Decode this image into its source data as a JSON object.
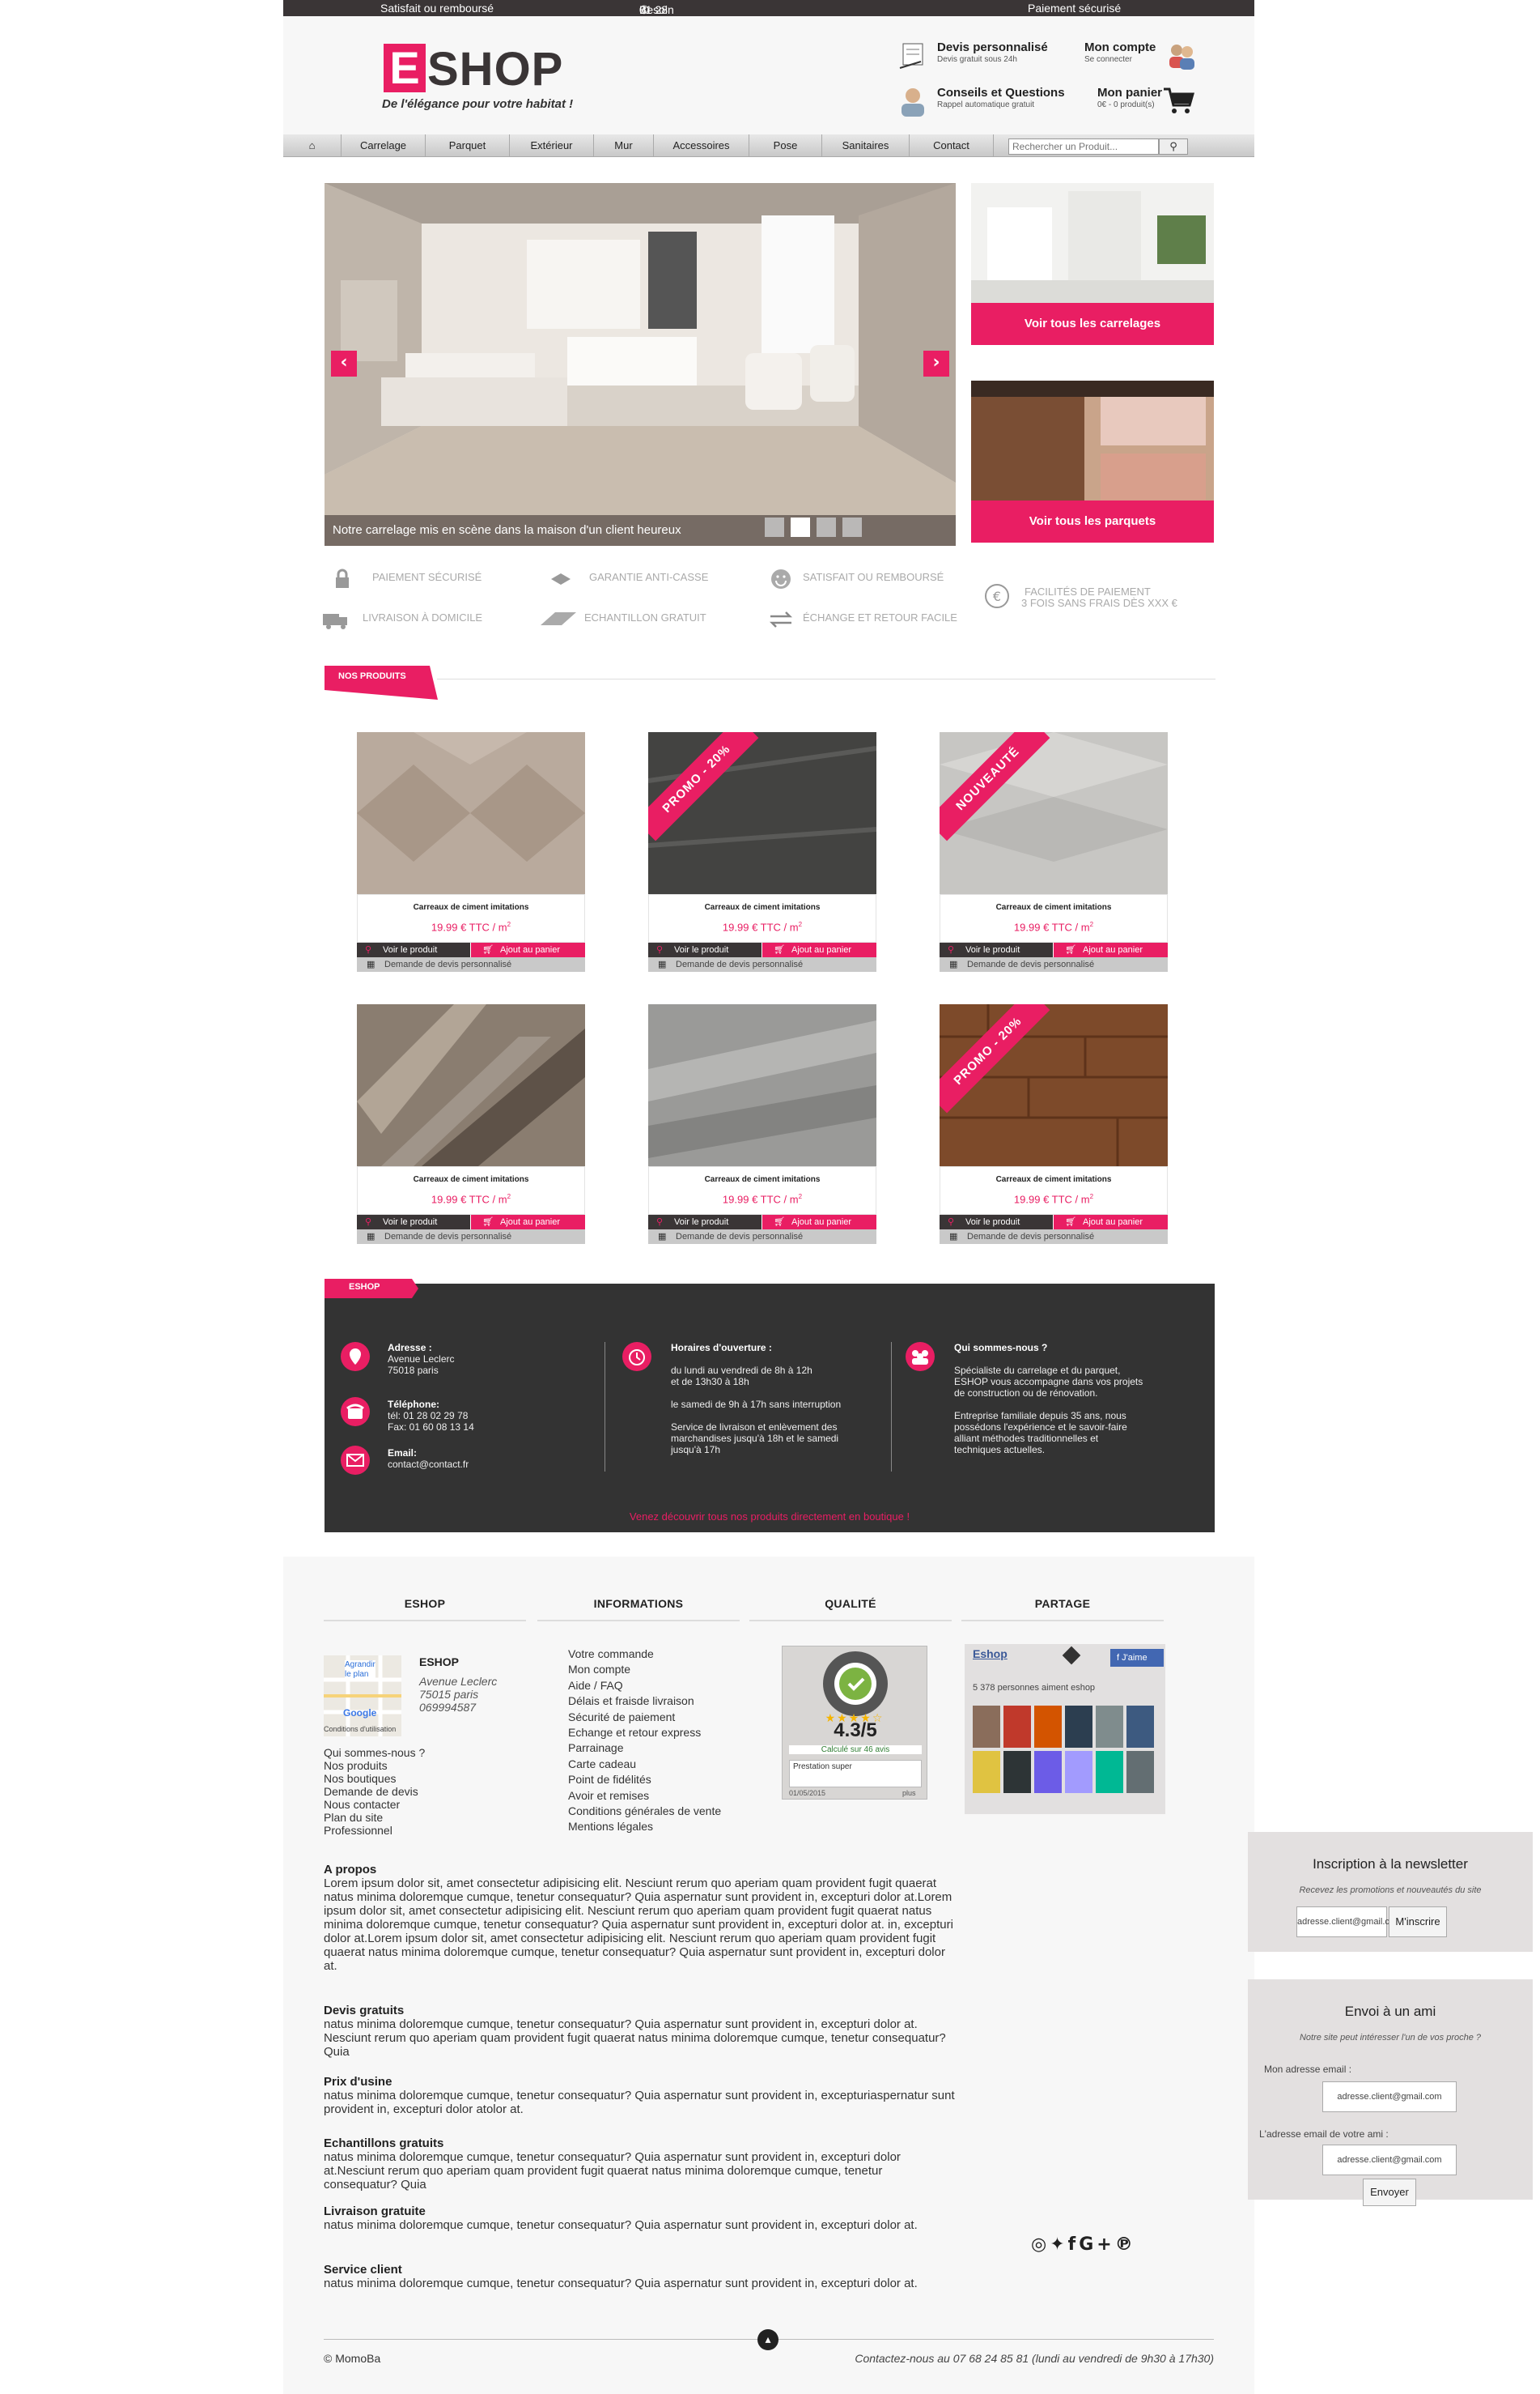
{
  "topbar": {
    "left": "Satisfait ou remboursé",
    "center": "Besoin d'aide ?",
    "phone": "01 28 02 29 45 (appel gratuit)",
    "right": "Paiement sécurisé"
  },
  "brand": {
    "logo_letter": "E",
    "logo_rest": "SHOP",
    "tagline": "De l'élégance pour votre habitat !"
  },
  "header": {
    "devis": {
      "title": "Devis personnalisé",
      "sub": "Devis gratuit sous 24h"
    },
    "account": {
      "title": "Mon compte",
      "sub": "Se connecter"
    },
    "conseils": {
      "title": "Conseils et Questions",
      "sub": "Rappel automatique gratuit"
    },
    "cart": {
      "title": "Mon panier",
      "sub": "0€ - 0 produit(s)"
    }
  },
  "nav": {
    "items": [
      "Carrelage",
      "Parquet",
      "Extérieur",
      "Mur",
      "Accessoires",
      "Pose",
      "Sanitaires",
      "Contact"
    ],
    "search_placeholder": "Rechercher un Produit..."
  },
  "slider": {
    "caption": "Notre carrelage mis en scène dans la maison d'un client heureux",
    "prev": "‹",
    "next": "›",
    "slides": 4,
    "active": 2
  },
  "promos": [
    {
      "label": "Voir tous les carrelages"
    },
    {
      "label": "Voir tous les parquets"
    }
  ],
  "features": [
    {
      "icon": "lock-icon",
      "text": "Paiement sécurisé"
    },
    {
      "icon": "tile-icon",
      "text": "Garantie anti-casse"
    },
    {
      "icon": "smiley-icon",
      "text": "Satisfait ou remboursé"
    },
    {
      "icon": "euro-icon",
      "text": "Facilités de paiement",
      "sub": "3 fois sans frais dès XXX €"
    },
    {
      "icon": "truck-icon",
      "text": "Livraison à domicile"
    },
    {
      "icon": "sample-icon",
      "text": "Echantillon gratuit"
    },
    {
      "icon": "exchange-icon",
      "text": "Échange et retour facile"
    }
  ],
  "section_title": "NOS PRODUITS",
  "products": [
    {
      "name": "Carreaux de ciment imitations",
      "price": "19.99 € TTC / m",
      "ribbon": ""
    },
    {
      "name": "Carreaux de ciment imitations",
      "price": "19.99 € TTC / m",
      "ribbon": "PROMO - 20%"
    },
    {
      "name": "Carreaux de ciment imitations",
      "price": "19.99 € TTC / m",
      "ribbon": "NOUVEAUTÉ"
    },
    {
      "name": "Carreaux de ciment imitations",
      "price": "19.99 € TTC / m",
      "ribbon": ""
    },
    {
      "name": "Carreaux de ciment imitations",
      "price": "19.99 € TTC / m",
      "ribbon": ""
    },
    {
      "name": "Carreaux de ciment imitations",
      "price": "19.99 € TTC / m",
      "ribbon": "PROMO - 20%"
    }
  ],
  "product_buttons": {
    "view": "Voir le produit",
    "cart": "Ajout au panier",
    "quote": "Demande de devis personnalisé",
    "unit_exp": "2"
  },
  "info": {
    "tag": "ESHOP",
    "address_title": "Adresse :",
    "address": "Avenue Leclerc",
    "city": "75018 paris",
    "phone_title": "Téléphone:",
    "tel": "tél: 01 28 02 29 78",
    "fax": "Fax: 01 60 08 13 14",
    "email_title": "Email:",
    "email": "contact@contact.fr",
    "hours_title": "Horaires d'ouverture :",
    "hours1": "du lundi au vendredi de 8h à 12h",
    "hours2": "et de 13h30 à 18h",
    "hours3": "le samedi de 9h à 17h sans interruption",
    "hours4": "Service de livraison et enlèvement des",
    "hours5": "marchandises jusqu'à 18h et le samedi",
    "hours6": "jusqu'à 17h",
    "who_title": "Qui sommes-nous ?",
    "who1": "Spécialiste du carrelage et du parquet,",
    "who2": "ESHOP vous accompagne dans vos projets",
    "who3": "de construction ou de rénovation.",
    "who4": "Entreprise familiale depuis 35 ans, nous",
    "who5": "possédons l'expérience et le savoir-faire",
    "who6": "alliant méthodes traditionnelles et",
    "who7": "techniques actuelles.",
    "cta": "Venez découvrir tous nos produits directement en boutique !"
  },
  "footer": {
    "headings": [
      "ESHOP",
      "INFORMATIONS",
      "QUALITÉ",
      "PARTAGE"
    ],
    "map": {
      "enlarge1": "Agrandir",
      "enlarge2": "le plan",
      "google": "Google",
      "conditions": "Conditions d'utilisation"
    },
    "eshop": {
      "name": "ESHOP",
      "street": "Avenue Leclerc",
      "city": "75015 paris",
      "phone": "069994587"
    },
    "eshop_links": [
      "Qui sommes-nous ?",
      "Nos produits",
      "Nos boutiques",
      "Demande de devis",
      "Nous contacter",
      "Plan du site",
      "Professionnel"
    ],
    "info_links": [
      "Votre commande",
      "Mon compte",
      "Aide / FAQ",
      "Délais et fraisde livraison",
      "Sécurité de paiement",
      "Echange et retour express",
      "Parrainage",
      "Carte cadeau",
      "Point de fidélités",
      "Avoir et remises",
      "Conditions générales de vente",
      "Mentions légales"
    ],
    "quality": {
      "badge": "LABEL QUALITÉ eKomi",
      "score": "4.3/5",
      "count": "Calculé sur 46 avis",
      "review": "Prestation super",
      "date": "01/05/2015",
      "more": "plus"
    },
    "share": {
      "page": "Eshop",
      "like": "J'aime",
      "likes": "5 378 personnes aiment eshop"
    },
    "newsletter": {
      "title": "Inscription à la newsletter",
      "sub": "Recevez les promotions et nouveautés du site",
      "placeholder": "adresse.client@gmail.com",
      "button": "M'inscrire"
    },
    "friend": {
      "title": "Envoi à un ami",
      "sub": "Notre site peut intéresser l'un de vos proche ?",
      "my_label": "Mon adresse email :",
      "my_value": "adresse.client@gmail.com",
      "friend_label": "L'adresse email de votre ami :",
      "friend_value": "adresse.client@gmail.com",
      "button": "Envoyer"
    },
    "about": [
      {
        "title": "A propos",
        "text": "Lorem ipsum dolor sit, amet consectetur adipisicing elit. Nesciunt rerum quo aperiam quam provident fugit quaerat natus minima doloremque cumque, tenetur consequatur? Quia aspernatur sunt provident in, excepturi dolor at.Lorem ipsum dolor sit, amet consectetur adipisicing elit. Nesciunt rerum quo aperiam quam provident fugit quaerat natus minima doloremque cumque, tenetur consequatur? Quia aspernatur sunt provident in, excepturi dolor at. in, excepturi dolor at.Lorem ipsum dolor sit, amet consectetur adipisicing elit. Nesciunt rerum quo aperiam quam provident fugit quaerat natus minima doloremque cumque, tenetur consequatur? Quia aspernatur sunt provident in, excepturi dolor at."
      },
      {
        "title": "Devis gratuits",
        "text": "natus minima doloremque cumque, tenetur consequatur? Quia aspernatur sunt provident in, excepturi dolor at. Nesciunt rerum quo aperiam quam provident fugit quaerat natus minima doloremque cumque, tenetur consequatur? Quia"
      },
      {
        "title": "Prix d'usine",
        "text": "natus minima doloremque cumque, tenetur consequatur? Quia aspernatur sunt provident in, excepturiaspernatur sunt provident in, excepturi dolor atolor at."
      },
      {
        "title": "Echantillons gratuits",
        "text": "natus minima doloremque cumque, tenetur consequatur? Quia aspernatur sunt provident in, excepturi dolor at.Nesciunt rerum quo aperiam quam provident fugit quaerat natus minima doloremque cumque, tenetur consequatur? Quia"
      },
      {
        "title": "Livraison gratuite",
        "text": "natus minima doloremque cumque, tenetur consequatur? Quia aspernatur sunt provident in, excepturi dolor at."
      },
      {
        "title": "Service client",
        "text": "natus minima doloremque cumque, tenetur consequatur? Quia aspernatur sunt provident in, excepturi dolor at."
      }
    ],
    "copyright": "© MomoBa",
    "contact_line": "Contactez-nous au 07 68 24 85 81 (lundi au vendredi de 9h30 à 17h30)"
  },
  "colors": {
    "accent": "#e91e63",
    "dark": "#3a3536",
    "light_bg": "#f7f7f7"
  }
}
